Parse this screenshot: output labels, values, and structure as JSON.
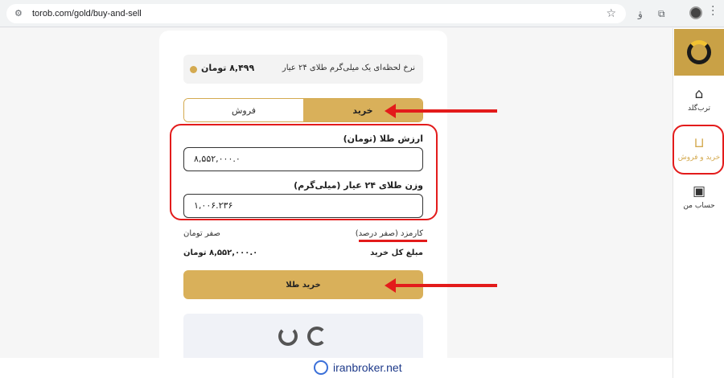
{
  "browser": {
    "url": "torob.com/gold/buy-and-sell",
    "translate_icon": "translate-icon",
    "extension_icon": "puzzle-icon"
  },
  "rate": {
    "label": "نرخ لحظه‌ای یک میلی‌گرم طلای ۲۴ عیار",
    "value": "۸,۴۹۹ تومان"
  },
  "tabs": {
    "buy": "خرید",
    "sell": "فروش"
  },
  "form": {
    "gold_value_label": "ارزش طلا (تومان)",
    "gold_value": "۸,۵۵۲,۰۰۰.۰",
    "weight_label": "وزن طلای ۲۴ عیار (میلی‌گرم)",
    "weight": "۱,۰۰۶.۲۳۶"
  },
  "summary": {
    "fee_label": "کارمزد (صفر درصد)",
    "fee_value": "صفر تومان",
    "total_label": "مبلغ کل خرید",
    "total_value": "۸,۵۵۲,۰۰۰.۰ تومان"
  },
  "buy_button": "خرید طلا",
  "sidebar": {
    "items": [
      {
        "label": "ترب‌گلد",
        "icon": "home-icon"
      },
      {
        "label": "خرید و فروش",
        "icon": "basket-icon"
      },
      {
        "label": "حساب من",
        "icon": "id-card-icon"
      }
    ]
  },
  "watermark": "iranbroker.net",
  "colors": {
    "gold": "#d9b05a",
    "annotation": "#e31b1b"
  }
}
